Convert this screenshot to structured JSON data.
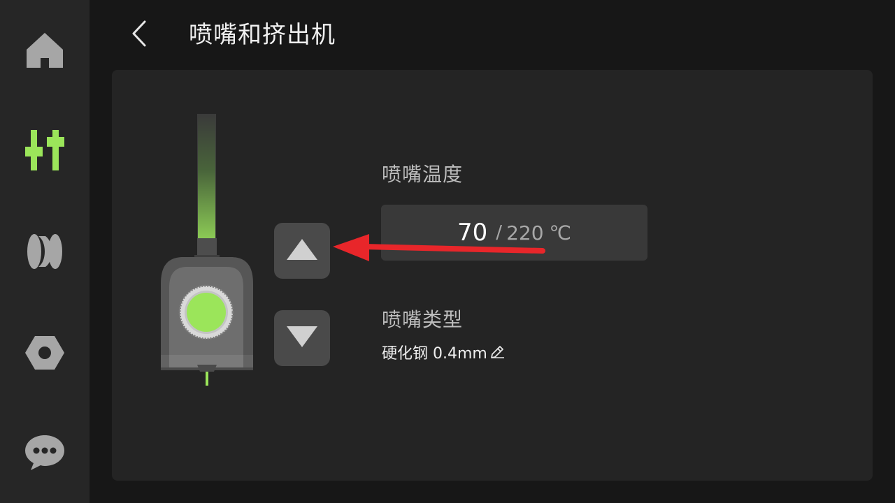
{
  "header": {
    "title": "喷嘴和挤出机"
  },
  "sidebar": {
    "items": [
      {
        "name": "home",
        "icon": "home-icon",
        "active": false
      },
      {
        "name": "controls",
        "icon": "sliders-icon",
        "active": true
      },
      {
        "name": "filament",
        "icon": "filament-spool-icon",
        "active": false
      },
      {
        "name": "settings",
        "icon": "hex-nut-icon",
        "active": false
      },
      {
        "name": "messages",
        "icon": "chat-bubble-icon",
        "active": false
      }
    ]
  },
  "nozzle": {
    "temp_label": "喷嘴温度",
    "current_temp": "70",
    "separator": "/",
    "target_temp": "220",
    "unit": "℃",
    "type_label": "喷嘴类型",
    "type_value": "硬化钢 0.4mm"
  },
  "colors": {
    "accent": "#9be55a",
    "background": "#171717",
    "sidebar": "#262626",
    "panel": "#242424",
    "button": "#4a4a4a",
    "icon_inactive": "#a6a6a6",
    "annotation": "#e8262a"
  }
}
